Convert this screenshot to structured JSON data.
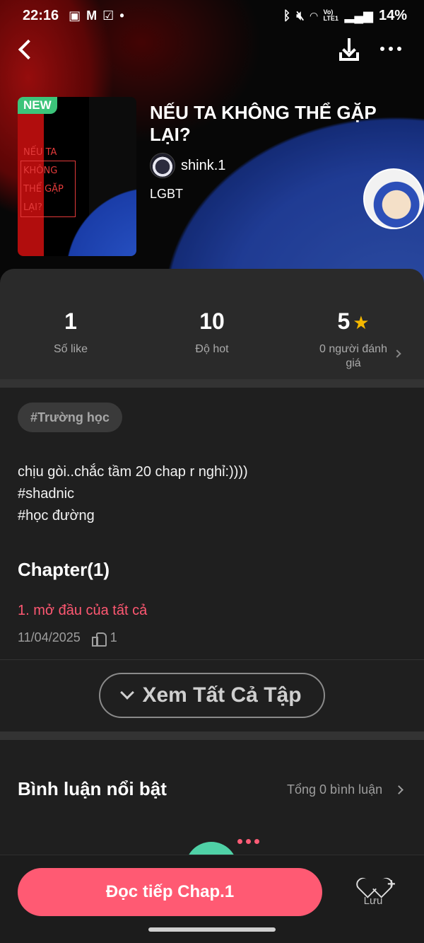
{
  "status_bar": {
    "time": "22:16",
    "left_icons": [
      "image-icon",
      "gmail-icon",
      "checkbox-icon",
      "dot-icon"
    ],
    "right_icons": [
      "bluetooth-icon",
      "mute-icon",
      "wifi-icon",
      "signal-icon"
    ],
    "network": "Vo) LTE1",
    "battery": "14%"
  },
  "header": {
    "cover_badge": "NEW",
    "cover_text": [
      "NẾU TA",
      "KHÔNG",
      "THỂ GẶP",
      "LẠI?"
    ],
    "title": "NẾU TA KHÔNG THỂ GẶP LẠI?",
    "author": "shink.1",
    "genre": "LGBT"
  },
  "stats": [
    {
      "value": "1",
      "label": "Số like"
    },
    {
      "value": "10",
      "label": "Độ hot"
    },
    {
      "value": "5",
      "label": "0 người đánh giá"
    }
  ],
  "tag": "#Trường học",
  "description": [
    "chịu gòi..chắc tầm 20 chap r nghỉ:))))",
    "#shadnic",
    "#học đường"
  ],
  "chapters": {
    "heading": "Chapter(1)",
    "items": [
      {
        "title": "1. mở đầu của tất cả",
        "date": "11/04/2025",
        "likes": "1"
      }
    ],
    "view_all": "Xem Tất Cả Tập"
  },
  "comments": {
    "heading": "Bình luận nổi bật",
    "total": "Tổng 0 bình luận"
  },
  "bottom": {
    "read_button": "Đọc tiếp Chap.1",
    "save_label": "Lưu"
  },
  "colors": {
    "accent": "#ff5a73",
    "chapter_link": "#ff5872",
    "badge": "#3cc47a",
    "star": "#f5b800",
    "background": "#1f1f1f"
  }
}
